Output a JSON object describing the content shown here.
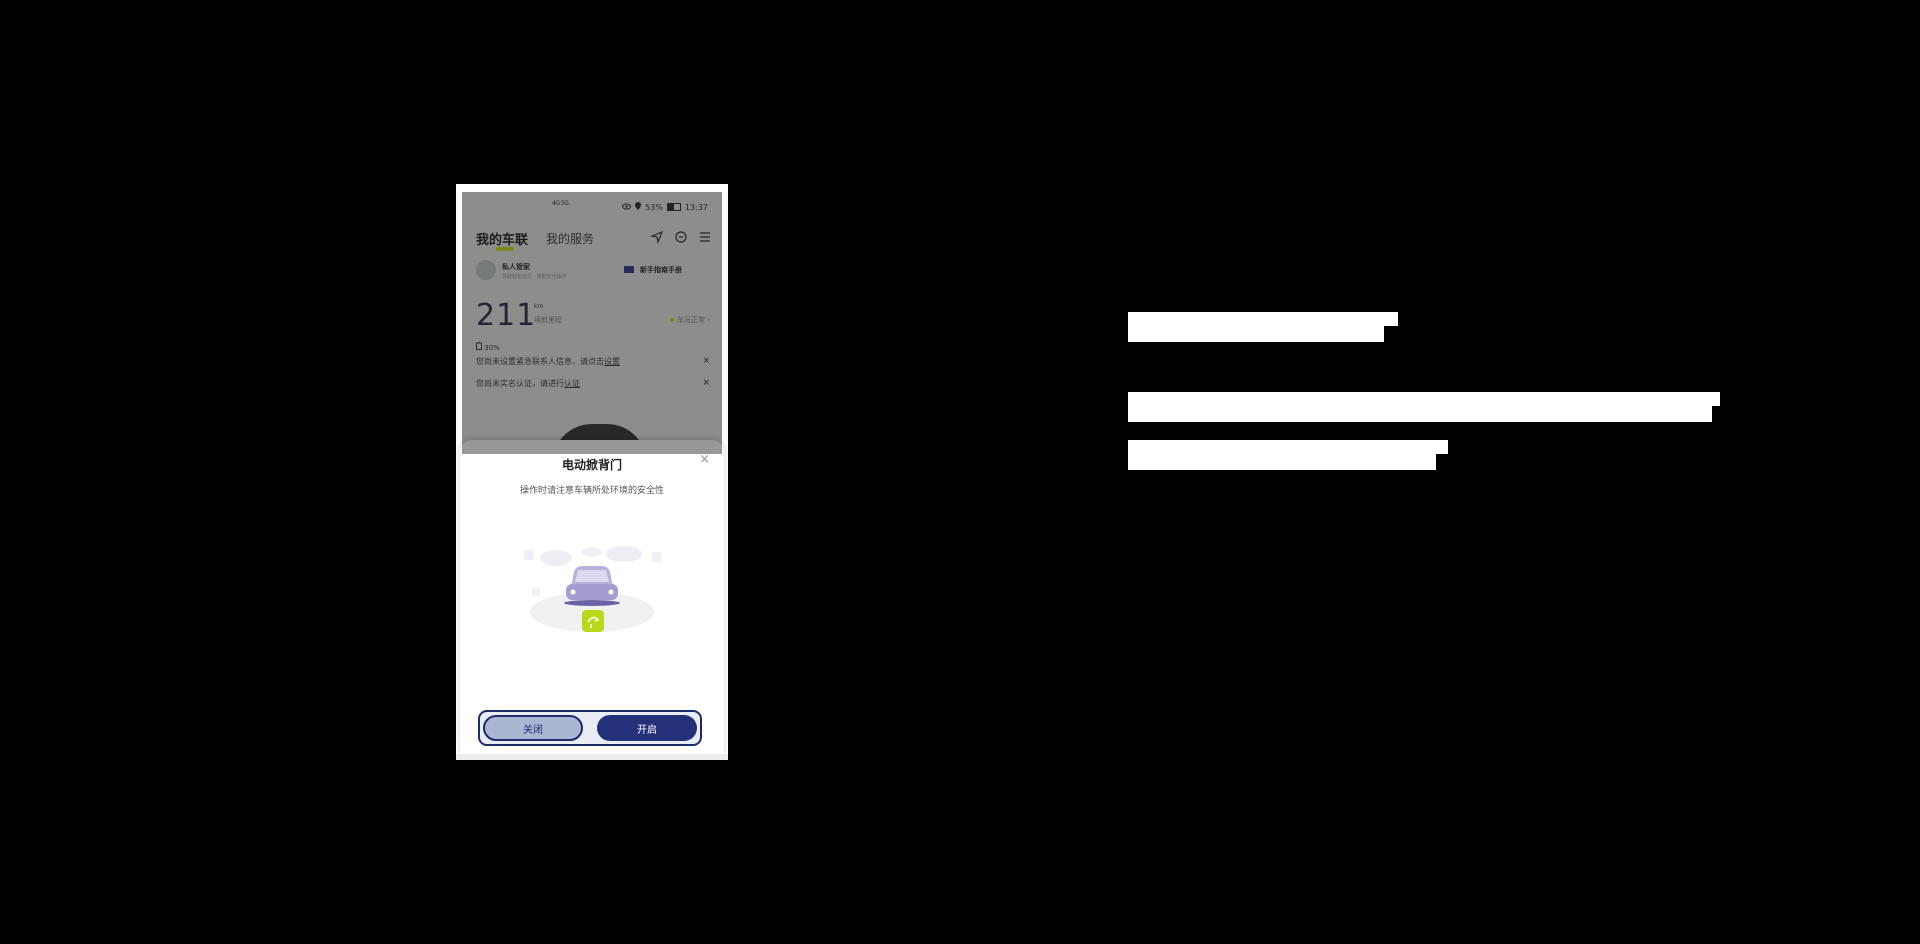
{
  "status_bar": {
    "sim_text": "4G 5G",
    "battery": "53%",
    "time": "13:37",
    "battery_level": 0.53
  },
  "nav": {
    "tab_active": "我的车联",
    "tab_other": "我的服务",
    "icons": [
      "navigate-icon",
      "chat-icon",
      "menu-icon"
    ]
  },
  "butler": {
    "name": "私人管家",
    "subtitle": "驾驶轻松出行 · 智能安全操作",
    "manual_label": "新手指南手册"
  },
  "vehicle": {
    "range_value": "211",
    "range_unit": "km",
    "range_desc": "续航里程",
    "status": "车况正常 ›",
    "soc": "30%"
  },
  "notices": [
    {
      "text": "您尚未设置紧急联系人信息，请点击",
      "link": "设置",
      "close": "×"
    },
    {
      "text": "您尚未实名认证，请进行",
      "link": "认证",
      "close": "×"
    }
  ],
  "sheet": {
    "title": "电动掀背门",
    "subtitle": "操作时请注意车辆所处环境的安全性",
    "close_icon": "×",
    "close_button": "关闭",
    "open_button": "开启"
  },
  "colors": {
    "accent_lime": "#c9e40f",
    "primary_navy": "#25307a",
    "secondary_button": "#aab6d2"
  }
}
